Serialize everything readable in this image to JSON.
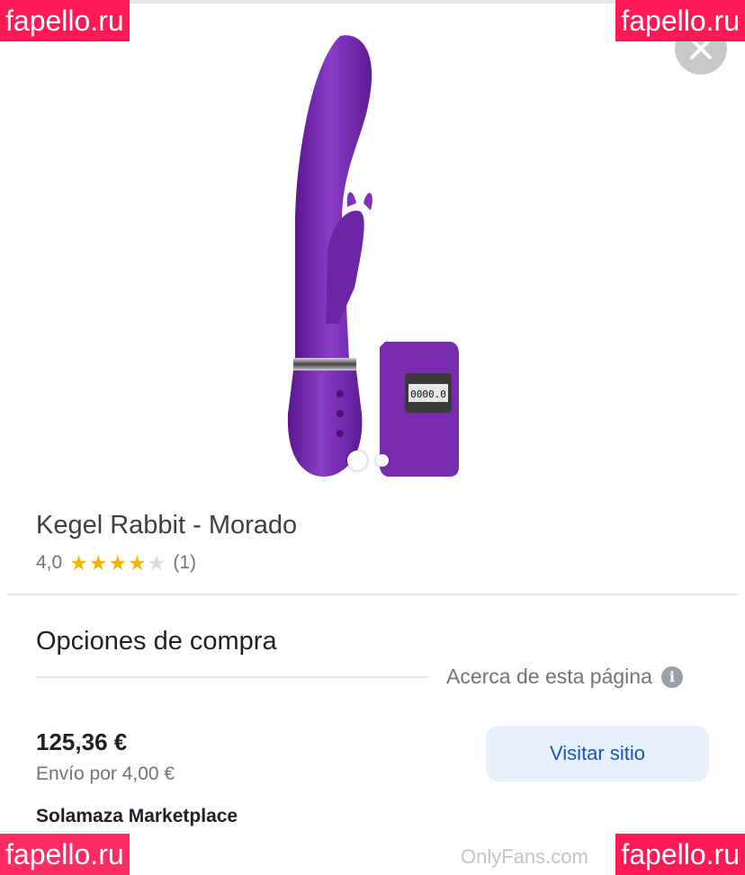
{
  "watermarks": {
    "top_left": "fapello.ru",
    "top_right": "fapello.ru",
    "bottom_left": "fapello.ru",
    "bottom_right": "fapello.ru",
    "onlyfans": "OnlyFans.com"
  },
  "product": {
    "title": "Kegel Rabbit - Morado",
    "rating_value": "4,0",
    "rating_stars": 4,
    "rating_max": 5,
    "review_count": "(1)",
    "remote_display": "0000.0",
    "image_slide_count": 2,
    "active_slide": 1,
    "icons": {
      "close": "close-icon",
      "info": "info-icon",
      "star": "star-icon"
    }
  },
  "buying": {
    "section_title": "Opciones de compra",
    "about_label": "Acerca de esta página",
    "price": "125,36 €",
    "shipping": "Envío por 4,00 €",
    "seller": "Solamaza Marketplace",
    "visit_button": "Visitar sitio"
  },
  "colors": {
    "accent_blue": "#1a56b8",
    "button_bg": "#e8f0fe",
    "star_color": "#f4b400",
    "product_purple": "#7a2cb0",
    "watermark_bg": "#ff1a55"
  }
}
